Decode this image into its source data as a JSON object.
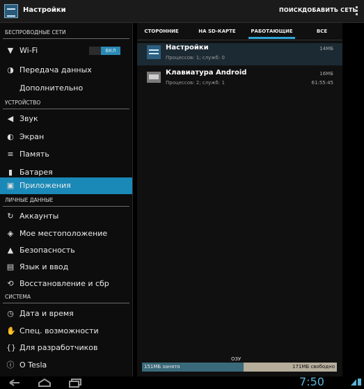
{
  "statusbar": {
    "title": "Настройки",
    "actions": [
      "ПОИСК",
      "ДОБАВИТЬ СЕТЬ"
    ]
  },
  "sidebar": {
    "sections": [
      {
        "label": "БЕСПРОВОДНЫЕ СЕТИ"
      },
      {
        "label": "УСТРОЙСТВО"
      },
      {
        "label": "ЛИЧНЫЕ ДАННЫЕ"
      },
      {
        "label": "СИСТЕМА"
      }
    ],
    "wifi_toggle": "ВКЛ",
    "items": [
      {
        "label": "Wi-Fi",
        "icon": "wifi-icon"
      },
      {
        "label": "Передача данных",
        "icon": "data-usage-icon"
      },
      {
        "label": "Дополнительно",
        "icon": ""
      },
      {
        "label": "Звук",
        "icon": "sound-icon"
      },
      {
        "label": "Экран",
        "icon": "display-icon"
      },
      {
        "label": "Память",
        "icon": "storage-icon"
      },
      {
        "label": "Батарея",
        "icon": "battery-icon"
      },
      {
        "label": "Приложения",
        "icon": "apps-icon"
      },
      {
        "label": "Аккаунты",
        "icon": "sync-icon"
      },
      {
        "label": "Мое местоположение",
        "icon": "location-icon"
      },
      {
        "label": "Безопасность",
        "icon": "lock-icon"
      },
      {
        "label": "Язык и ввод",
        "icon": "language-icon"
      },
      {
        "label": "Восстановление и сбр",
        "icon": "backup-icon"
      },
      {
        "label": "Дата и время",
        "icon": "clock-icon"
      },
      {
        "label": "Спец. возможности",
        "icon": "accessibility-icon"
      },
      {
        "label": "Для разработчиков",
        "icon": "developer-icon"
      },
      {
        "label": "O Tesla",
        "icon": "info-icon"
      }
    ]
  },
  "tabs": [
    "СТОРОННИЕ",
    "НА SD-КАРТЕ",
    "РАБОТАЮЩИЕ",
    "ВСЕ"
  ],
  "apps": [
    {
      "name": "Настройки",
      "sub": "Процессов: 1; служб: 0",
      "size": "14МБ",
      "time": ""
    },
    {
      "name": "Клавиатура Android",
      "sub": "Процессов: 2; служб: 1",
      "size": "16МБ",
      "time": "61:55:45"
    }
  ],
  "ram": {
    "caption": "ОЗУ",
    "used_label": "151МБ занято",
    "free_label": "171МБ свободно",
    "used_fraction": 0.52
  },
  "clock": "7:50"
}
